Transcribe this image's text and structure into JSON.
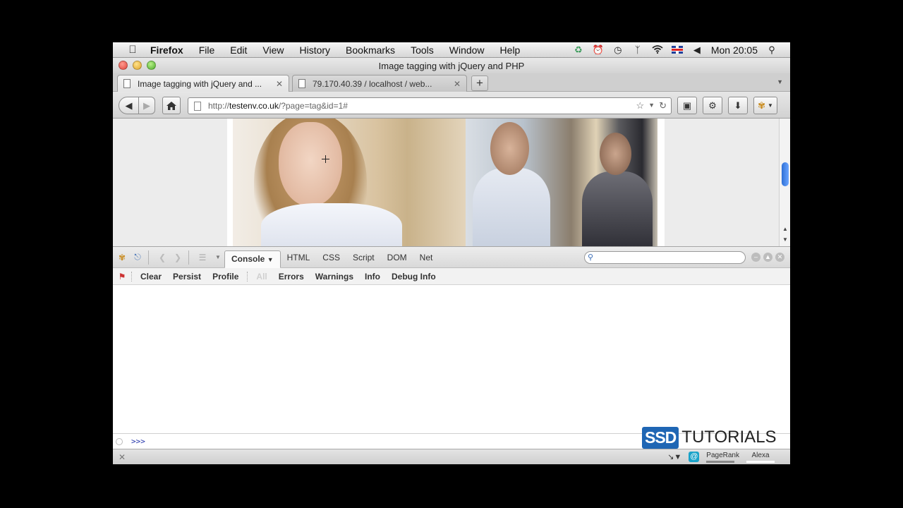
{
  "menubar": {
    "app": "Firefox",
    "items": [
      "File",
      "Edit",
      "View",
      "History",
      "Bookmarks",
      "Tools",
      "Window",
      "Help"
    ],
    "clock": "Mon 20:05"
  },
  "window": {
    "title": "Image tagging with jQuery and PHP"
  },
  "tabs": [
    {
      "label": "Image tagging with jQuery and ..."
    },
    {
      "label": "79.170.40.39 / localhost / web..."
    }
  ],
  "urlbar": {
    "proto": "http://",
    "host": "testenv.co.uk",
    "path": "/?page=tag&id=1#"
  },
  "firebug": {
    "tabs": [
      "Console",
      "HTML",
      "CSS",
      "Script",
      "DOM",
      "Net"
    ],
    "console_arrow": "▼",
    "subtoolbar": [
      "Clear",
      "Persist",
      "Profile"
    ],
    "filter_all": "All",
    "filters": [
      "Errors",
      "Warnings",
      "Info",
      "Debug Info"
    ],
    "prompt": ">>>"
  },
  "statusbar": {
    "pagerank": "PageRank",
    "alexa": "Alexa"
  },
  "watermark": {
    "brand": "SSD",
    "text": "TUTORIALS"
  },
  "colors": {
    "accent": "#1f66b4",
    "scroll_thumb": "#2e6fd6"
  }
}
